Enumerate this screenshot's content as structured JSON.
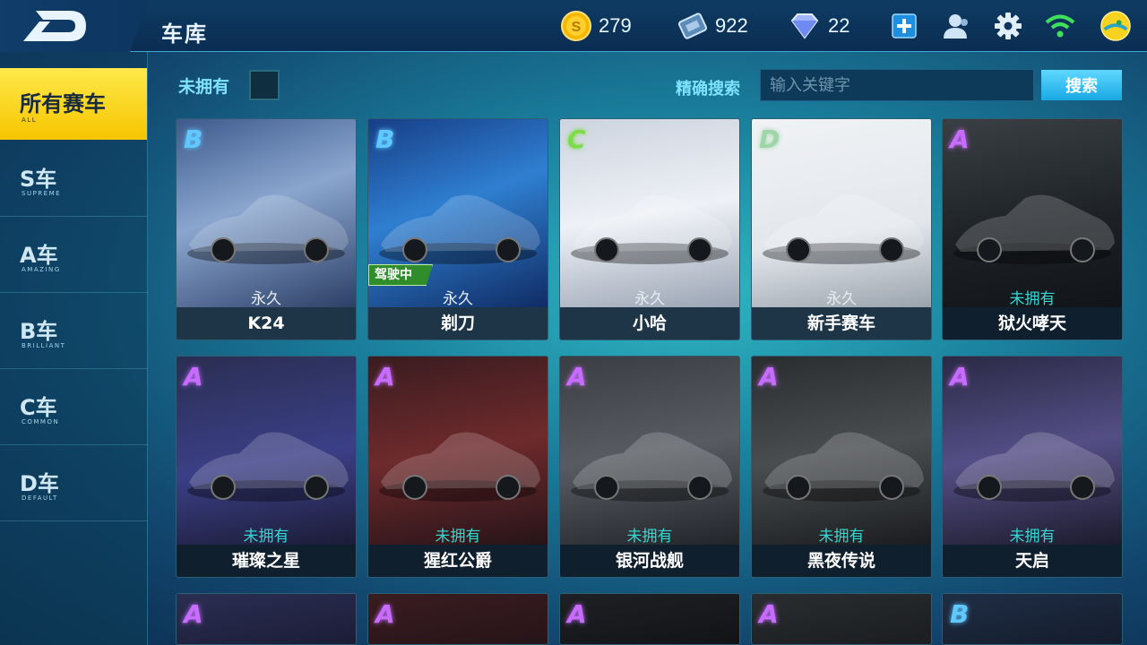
{
  "header": {
    "title": "车库",
    "gold": "279",
    "tickets": "922",
    "gems": "22"
  },
  "sidebar": {
    "items": [
      {
        "cn": "所有赛车",
        "en": "ALL"
      },
      {
        "cn": "S车",
        "en": "SUPREME"
      },
      {
        "cn": "A车",
        "en": "AMAZING"
      },
      {
        "cn": "B车",
        "en": "BRILLIANT"
      },
      {
        "cn": "C车",
        "en": "COMMON"
      },
      {
        "cn": "D车",
        "en": "DEFAULT"
      }
    ]
  },
  "filter": {
    "unowned_label": "未拥有",
    "search_label": "精确搜索",
    "search_placeholder": "输入关键字",
    "search_button": "搜索"
  },
  "cars": [
    {
      "grade": "B",
      "status": "永久",
      "name": "K24"
    },
    {
      "grade": "B",
      "status": "永久",
      "name": "剃刀",
      "badge": "驾驶中"
    },
    {
      "grade": "C",
      "status": "永久",
      "name": "小哈"
    },
    {
      "grade": "D",
      "status": "永久",
      "name": "新手赛车"
    },
    {
      "grade": "A",
      "status": "未拥有",
      "name": "狱火哮天"
    },
    {
      "grade": "A",
      "status": "未拥有",
      "name": "璀璨之星"
    },
    {
      "grade": "A",
      "status": "未拥有",
      "name": "猩红公爵"
    },
    {
      "grade": "A",
      "status": "未拥有",
      "name": "银河战舰"
    },
    {
      "grade": "A",
      "status": "未拥有",
      "name": "黑夜传说"
    },
    {
      "grade": "A",
      "status": "未拥有",
      "name": "天启"
    },
    {
      "grade": "A"
    },
    {
      "grade": "A"
    },
    {
      "grade": "A"
    },
    {
      "grade": "A"
    },
    {
      "grade": "B"
    }
  ],
  "colors": {
    "grade_A": "#c86bff",
    "grade_B": "#5fc8ff",
    "grade_C": "#7ddc4a",
    "grade_D": "#9fd6a8",
    "accent_yellow": "#f6d000",
    "unowned_teal": "#36d7d2"
  }
}
